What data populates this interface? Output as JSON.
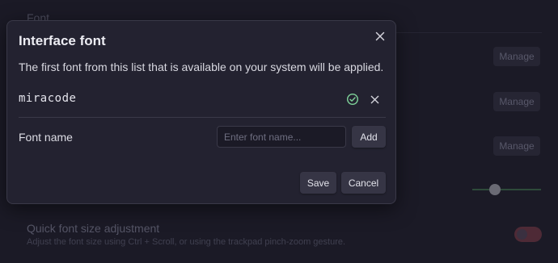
{
  "background": {
    "section_heading": "Font",
    "manage_buttons": [
      "Manage",
      "Manage",
      "Manage"
    ],
    "quick_adjust_title": "Quick font size adjustment",
    "quick_adjust_desc": "Adjust the font size using Ctrl + Scroll, or using the trackpad pinch-zoom gesture.",
    "toggle_state": "off"
  },
  "modal": {
    "title": "Interface font",
    "description": "The first font from this list that is available on your system will be applied.",
    "fonts": [
      {
        "name": "miracode",
        "status": "available",
        "status_icon": "check-circle-icon"
      }
    ],
    "field_label": "Font name",
    "input_placeholder": "Enter font name...",
    "input_value": "",
    "add_label": "Add",
    "save_label": "Save",
    "cancel_label": "Cancel"
  },
  "colors": {
    "available": "#7fd39a",
    "background": "#1b1a26",
    "modal": "#232230"
  }
}
